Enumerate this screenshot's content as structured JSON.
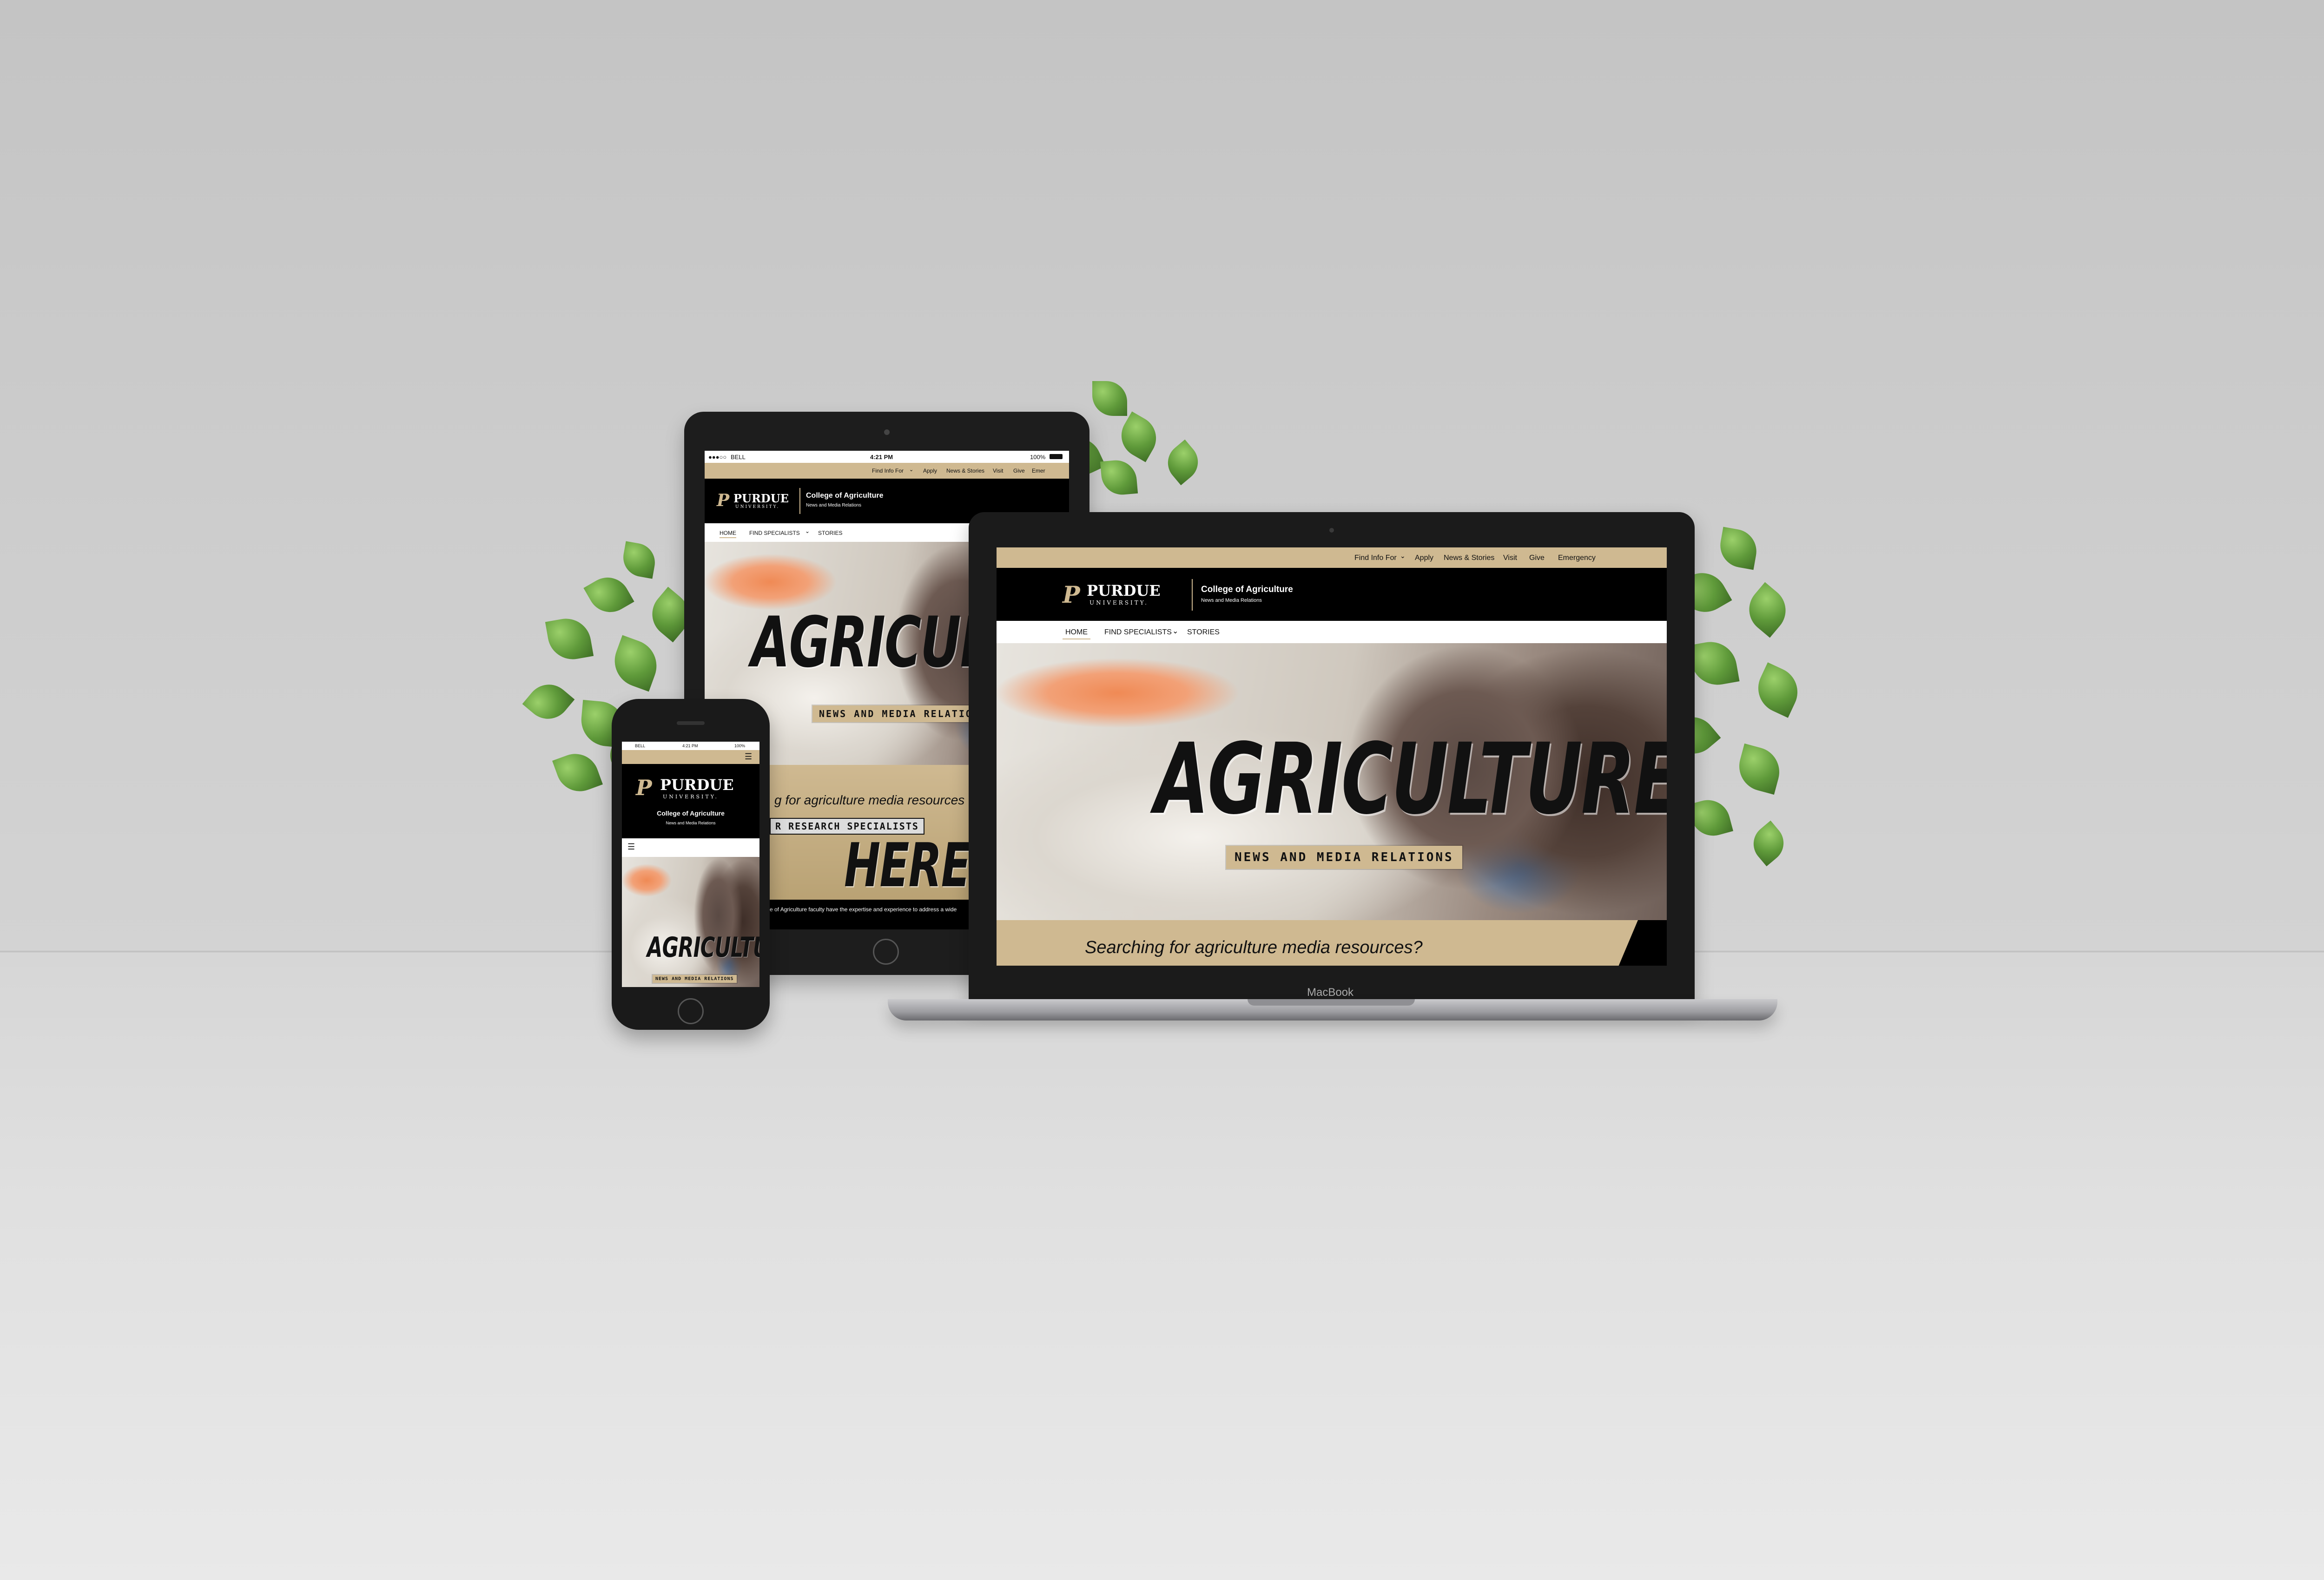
{
  "brand": {
    "logo_word": "PURDUE",
    "logo_sub": "UNIVERSITY.",
    "college": "College of Agriculture",
    "subunit": "News and Media Relations"
  },
  "status_bar": {
    "carrier": "BELL",
    "time": "4:21 PM",
    "battery": "100%"
  },
  "top_links": [
    "Find Info For",
    "Apply",
    "News & Stories",
    "Visit",
    "Give",
    "Emergency"
  ],
  "tablet_top_links": [
    "Find Info For",
    "Apply",
    "News & Stories",
    "Visit",
    "Give",
    "Emer"
  ],
  "nav": [
    "HOME",
    "FIND SPECIALISTS",
    "STORIES"
  ],
  "hero": {
    "headline": "AGRICULTURE",
    "tablet_headline": "AGRICULTU",
    "tag": "NEWS AND MEDIA RELATIONS",
    "tablet_tag": "NEWS AND MEDIA RELATION"
  },
  "cta": {
    "searching": "Searching for agriculture media resources?",
    "tablet_searching": "g for agriculture media resources",
    "tablet_button": "R RESEARCH SPECIALISTS",
    "here": "HERE.",
    "tablet_body": "e of Agriculture faculty have the expertise and experience to address a wide"
  },
  "laptop_label": "MacBook",
  "icons": {
    "menu": "hamburger-icon",
    "chevron": "chevron-down-icon",
    "wifi": "wifi-icon",
    "home_button": "home-button-icon"
  },
  "colors": {
    "gold": "#cfb991",
    "black": "#000000",
    "wall": "#c8c8c8",
    "floor": "#e2e2e2"
  }
}
